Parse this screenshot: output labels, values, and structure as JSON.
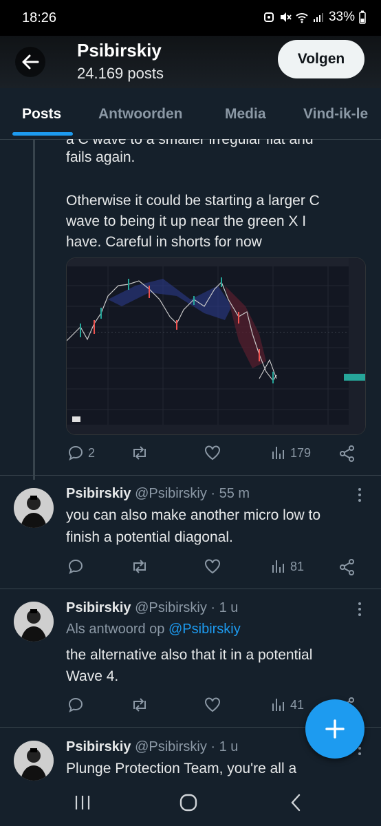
{
  "status_bar": {
    "time": "18:26",
    "battery": "33%"
  },
  "header": {
    "name": "Psibirskiy",
    "posts_count": "24.169 posts",
    "follow_label": "Volgen"
  },
  "tabs": [
    {
      "label": "Posts"
    },
    {
      "label": "Antwoorden"
    },
    {
      "label": "Media"
    },
    {
      "label": "Vind-ik-le"
    }
  ],
  "tweet1": {
    "cut_line": "a C wave to a smaller irregular flat and",
    "line1": "fails again.",
    "para2_line1": "Otherwise it could be starting a larger C",
    "para2_line2": "wave to being it up near the green X I",
    "para2_line3": "have.  Careful in shorts for now",
    "replies": "2",
    "views": "179"
  },
  "tweet2": {
    "name": "Psibirskiy",
    "handle_time": "@Psibirskiy · 55 m",
    "line1": "you can also make another micro low to",
    "line2": "finish a potential diagonal.",
    "views": "81"
  },
  "tweet3": {
    "name": "Psibirskiy",
    "handle_time": "@Psibirskiy · 1 u",
    "reply_prefix": "Als antwoord op",
    "reply_handle": "@Psibirskiy",
    "line1": "the alternative also that it in a potential",
    "line2": "Wave 4.",
    "views": "41"
  },
  "tweet4": {
    "name": "Psibirskiy",
    "handle_time": "@Psibirskiy · 1 u",
    "line1": "Plunge Protection Team, you're all a"
  },
  "colors": {
    "accent": "#1d9bf0",
    "background": "#15202b",
    "muted": "#8b98a5"
  }
}
